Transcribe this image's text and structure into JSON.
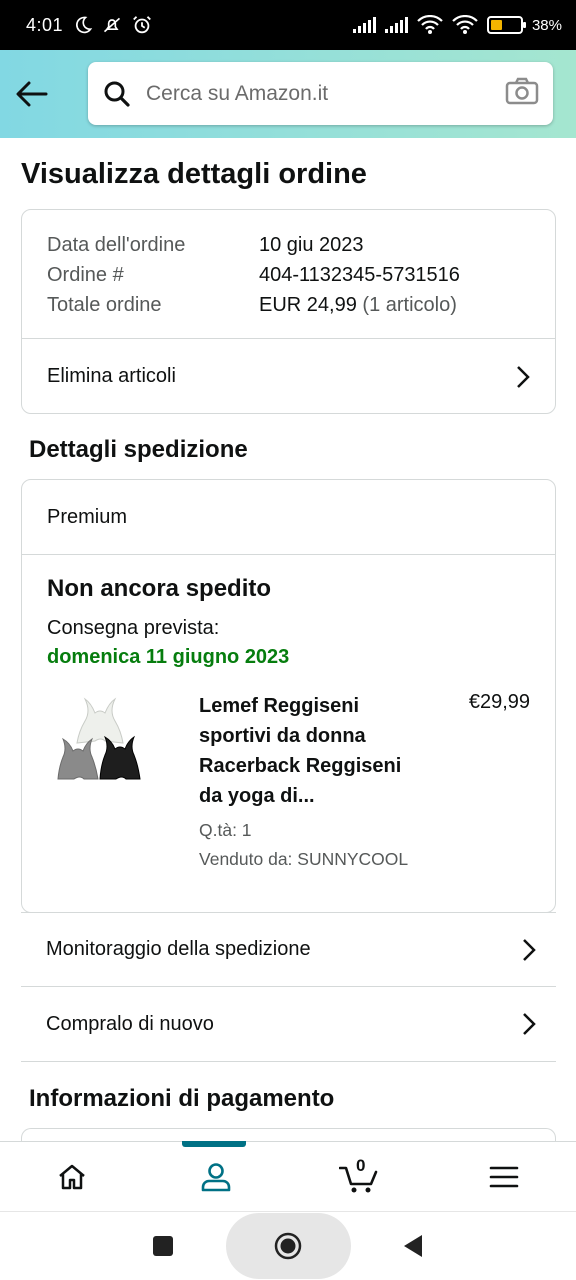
{
  "status_bar": {
    "time": "4:01",
    "battery_percent": "38",
    "battery_level": 0.38,
    "icons": [
      "moon-icon",
      "notifications-off-icon",
      "alarm-icon",
      "signal-icon",
      "signal-icon",
      "wifi-icon",
      "hotspot-icon",
      "battery-icon"
    ]
  },
  "header": {
    "back_icon": "arrow-left-icon",
    "search_placeholder": "Cerca su Amazon.it",
    "search_icon": "search-icon",
    "camera_icon": "camera-icon"
  },
  "page": {
    "title": "Visualizza dettagli ordine"
  },
  "order": {
    "rows": [
      {
        "label": "Data dell'ordine",
        "value": "10 giu 2023",
        "extra": ""
      },
      {
        "label": "Ordine #",
        "value": "404-1132345-5731516",
        "extra": ""
      },
      {
        "label": "Totale ordine",
        "value": "EUR 24,99",
        "extra": "(1 articolo)"
      }
    ],
    "delete_items_label": "Elimina articoli"
  },
  "shipping": {
    "section_title": "Dettagli spedizione",
    "shipping_type": "Premium",
    "status": "Non ancora spedito",
    "delivery_label": "Consegna prevista:",
    "delivery_date": "domenica 11 giugno 2023",
    "delivery_date_color": "#067d0e",
    "item": {
      "title_lines": [
        "Lemef Reggiseni",
        "sportivi da donna",
        "Racerback Reggiseni",
        "da yoga di..."
      ],
      "quantity": "Q.tà: 1",
      "seller": "Venduto da: SUNNYCOOL",
      "price": "€29,99"
    }
  },
  "actions": {
    "track": "Monitoraggio della spedizione",
    "buy_again": "Compralo di nuovo"
  },
  "payment": {
    "section_title": "Informazioni di pagamento"
  },
  "bottom_nav": {
    "cart_count": "0",
    "accent": "#007185",
    "items": [
      "home-icon",
      "account-icon",
      "cart-icon",
      "menu-icon"
    ]
  },
  "system_nav": {
    "items": [
      "recents-icon",
      "home-icon",
      "back-icon"
    ]
  }
}
